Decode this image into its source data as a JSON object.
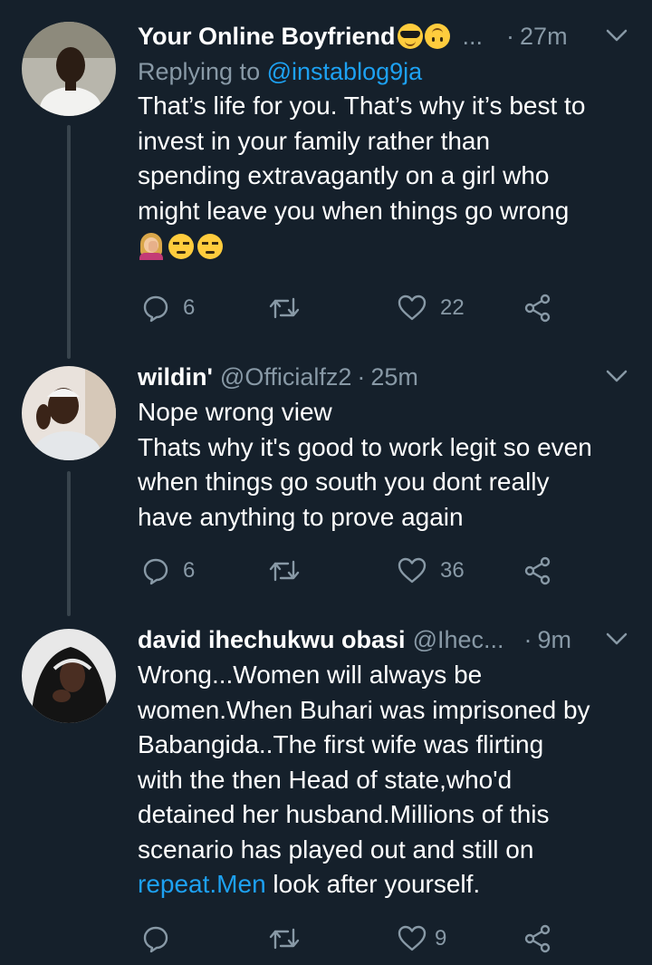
{
  "tweets": [
    {
      "name": "Your Online Boyfriend",
      "name_emojis": [
        "smiling-face-with-sunglasses",
        "upside-down-face"
      ],
      "ellipsis": "...",
      "time": "27m",
      "dot": "·",
      "reply_prefix": "Replying to",
      "reply_mention": "@instablog9ja",
      "text": "That’s life for you. That’s why it’s best to\ninvest in your family rather than\nspending extravagantly on a girl who\nmight leave you when things go wrong",
      "text_emojis": [
        "woman-facepalming",
        "unamused-face",
        "unamused-face"
      ],
      "replies": "6",
      "retweets": "",
      "likes": "22"
    },
    {
      "name": "wildin'",
      "handle": "@Officialfz2",
      "dot": "·",
      "time": "25m",
      "text": "Nope wrong view\nThats why it's good to work legit so even\nwhen things go south you dont really\nhave anything to prove again",
      "replies": "6",
      "retweets": "",
      "likes": "36"
    },
    {
      "name": "david ihechukwu obasi",
      "handle": "@Ihec...",
      "dot": "·",
      "time": "9m",
      "text_before_link": "Wrong...Women will always be\nwomen.When Buhari was imprisoned by\nBabangida..The first wife was flirting\nwith the then Head of state,who'd\ndetained her husband.Millions of this\nscenario has played out and still on\n",
      "link": "repeat.Men",
      "text_after_link": " look after yourself.",
      "replies": "",
      "retweets": "",
      "likes": "9"
    }
  ],
  "icons": [
    "reply-icon",
    "retweet-icon",
    "like-icon",
    "share-icon",
    "chevron-down-icon"
  ],
  "colors": {
    "background": "#15202b",
    "secondary_text": "#8899a6",
    "link": "#1da1f2",
    "thread_line": "#38444d"
  }
}
